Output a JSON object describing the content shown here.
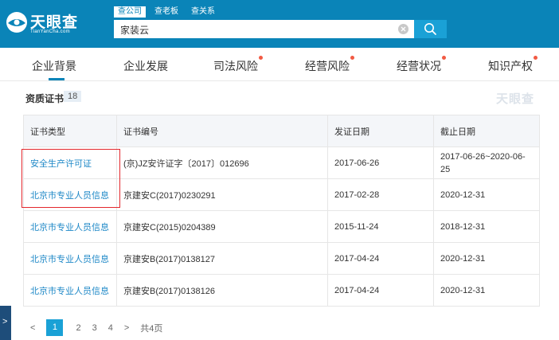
{
  "brand": {
    "name": "天眼查",
    "subtitle": "TianYanCha.com",
    "watermark": "天眼查"
  },
  "search": {
    "tabs": [
      "查公司",
      "查老板",
      "查关系"
    ],
    "query": "家装云"
  },
  "nav": {
    "items": [
      "企业背景",
      "企业发展",
      "司法风险",
      "经营风险",
      "经营状况",
      "知识产权"
    ]
  },
  "section": {
    "title": "资质证书",
    "count": "18"
  },
  "table": {
    "headers": [
      "证书类型",
      "证书编号",
      "发证日期",
      "截止日期"
    ],
    "rows": [
      [
        "安全生产许可证",
        "(京)JZ安许证字〔2017〕012696",
        "2017-06-26",
        "2017-06-26~2020-06-25"
      ],
      [
        "北京市专业人员信息",
        "京建安C(2017)0230291",
        "2017-02-28",
        "2020-12-31"
      ],
      [
        "北京市专业人员信息",
        "京建安C(2015)0204389",
        "2015-11-24",
        "2018-12-31"
      ],
      [
        "北京市专业人员信息",
        "京建安B(2017)0138127",
        "2017-04-24",
        "2020-12-31"
      ],
      [
        "北京市专业人员信息",
        "京建安B(2017)0138126",
        "2017-04-24",
        "2020-12-31"
      ]
    ]
  },
  "pagination": {
    "prev": "<",
    "pages": [
      "1",
      "2",
      "3",
      "4"
    ],
    "next": ">",
    "total": "共4页",
    "current": "1"
  },
  "side_tab": {
    "label": ">"
  },
  "colors": {
    "header_bg": "#0a84b8",
    "accent": "#1aa1d6",
    "link": "#1e88c7",
    "dot": "#f25a43",
    "highlight": "#e3272c"
  }
}
